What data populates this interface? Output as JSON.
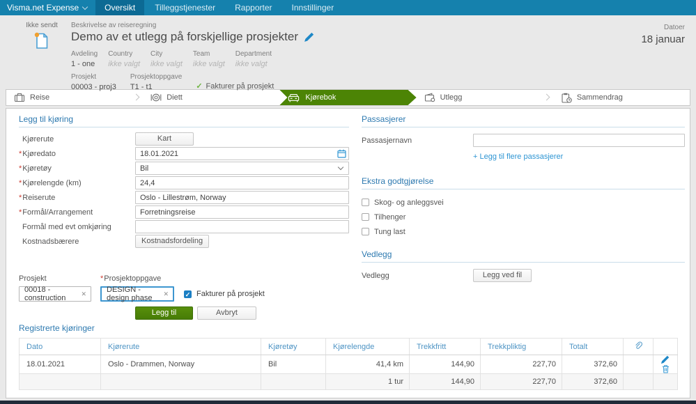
{
  "colors": {
    "navbar": "#1581ad",
    "navbar_active": "#0c6a94",
    "accent_blue": "#2e7ab0",
    "link_blue": "#2e95d3",
    "active_tab_green": "#4c8405",
    "status_dot_orange": "#f0a030",
    "checked_blue": "#1c7fc4"
  },
  "icons": {
    "check": "✓",
    "close": "✕"
  },
  "nav": {
    "brand": "Visma.net Expense",
    "items": [
      "Oversikt",
      "Tilleggstjenester",
      "Rapporter",
      "Innstillinger"
    ]
  },
  "header": {
    "status": "Ikke sendt",
    "description_label": "Beskrivelse av reiseregning",
    "title": "Demo av et utlegg på forskjellige prosjekter",
    "dates_label": "Datoer",
    "dates_value": "18 januar",
    "meta": [
      {
        "label": "Avdeling",
        "value": "1 - one",
        "empty": false
      },
      {
        "label": "Country",
        "value": "ikke valgt",
        "empty": true
      },
      {
        "label": "City",
        "value": "ikke valgt",
        "empty": true
      },
      {
        "label": "Team",
        "value": "ikke valgt",
        "empty": true
      },
      {
        "label": "Department",
        "value": "ikke valgt",
        "empty": true
      }
    ],
    "meta2": [
      {
        "label": "Prosjekt",
        "value": "00003 - proj3"
      },
      {
        "label": "Prosjektoppgave",
        "value": "T1 - t1"
      }
    ],
    "invoice_flag": "Fakturer på prosjekt"
  },
  "tabs": {
    "reise": "Reise",
    "diett": "Diett",
    "kjorebok": "Kjørebok",
    "utlegg": "Utlegg",
    "sammendrag": "Sammendrag"
  },
  "drive_form": {
    "section_title": "Legg til kjøring",
    "kjorerute_label": "Kjørerute",
    "kart_button": "Kart",
    "kjoredato_label": "Kjøredato",
    "kjoredato_value": "18.01.2021",
    "kjoretoy_label": "Kjøretøy",
    "kjoretoy_value": "Bil",
    "kjorelengde_label": "Kjørelengde (km)",
    "kjorelengde_value": "24,4",
    "reiserute_label": "Reiserute",
    "reiserute_value": "Oslo - Lillestrøm, Norway",
    "formal_label": "Formål/Arrangement",
    "formal_value": "Forretningsreise",
    "omkjoring_label": "Formål med evt omkjøring",
    "kostnadsbarere_label": "Kostnadsbærere",
    "kostnadsfordeling_button": "Kostnadsfordeling"
  },
  "passengers": {
    "section_title": "Passasjerer",
    "name_label": "Passasjernavn",
    "add_more_link": "+ Legg til flere passasjerer"
  },
  "extra": {
    "section_title": "Ekstra godtgjørelse",
    "options": [
      "Skog- og anleggsvei",
      "Tilhenger",
      "Tung last"
    ]
  },
  "attachments": {
    "section_title": "Vedlegg",
    "label": "Vedlegg",
    "button": "Legg ved fil"
  },
  "project": {
    "prosjekt_label": "Prosjekt",
    "prosjekt_value": "00018 - construction",
    "oppgave_label": "Prosjektoppgave",
    "oppgave_value": "DESIGN - design phase",
    "invoice_label": "Fakturer på prosjekt",
    "add_button": "Legg til",
    "cancel_button": "Avbryt"
  },
  "drives_table": {
    "section_title": "Registrerte kjøringer",
    "headers": [
      "Dato",
      "Kjørerute",
      "Kjøretøy",
      "Kjørelengde",
      "Trekkfritt",
      "Trekkpliktig",
      "Totalt"
    ],
    "rows": [
      {
        "dato": "18.01.2021",
        "rute": "Oslo - Drammen, Norway",
        "kjoretoy": "Bil",
        "lengde": "41,4 km",
        "trekkfritt": "144,90",
        "trekkpliktig": "227,70",
        "totalt": "372,60"
      }
    ],
    "footer": {
      "turer": "1 tur",
      "trekkfritt": "144,90",
      "trekkpliktig": "227,70",
      "totalt": "372,60"
    }
  }
}
